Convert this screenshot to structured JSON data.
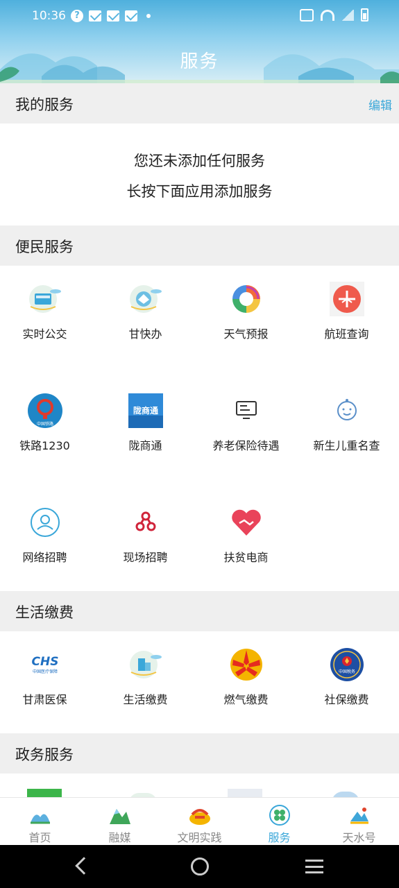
{
  "status_bar": {
    "time": "10:36",
    "question_glyph": "?"
  },
  "header": {
    "title": "服务"
  },
  "my_services": {
    "title": "我的服务",
    "edit_label": "编辑",
    "empty_line1": "您还未添加任何服务",
    "empty_line2": "长按下面应用添加服务"
  },
  "convenience": {
    "title": "便民服务",
    "items": [
      {
        "label": "实时公交",
        "icon": "bus-card-icon"
      },
      {
        "label": "甘快办",
        "icon": "gankuaiban-icon"
      },
      {
        "label": "天气预报",
        "icon": "weather-icon"
      },
      {
        "label": "航班查询",
        "icon": "flight-icon"
      },
      {
        "label": "铁路1230",
        "icon": "railway-icon",
        "badge": "中国铁路"
      },
      {
        "label": "陇商通",
        "icon": "longshangtong-icon",
        "badge": "陇商通"
      },
      {
        "label": "养老保险待遇",
        "icon": "pension-icon"
      },
      {
        "label": "新生儿重名查",
        "icon": "baby-icon"
      },
      {
        "label": "网络招聘",
        "icon": "online-recruit-icon"
      },
      {
        "label": "现场招聘",
        "icon": "onsite-recruit-icon"
      },
      {
        "label": "扶贫电商",
        "icon": "poverty-ecommerce-icon"
      }
    ]
  },
  "payments": {
    "title": "生活缴费",
    "items": [
      {
        "label": "甘肃医保",
        "icon": "medical-insurance-icon",
        "badge": "CHS",
        "sub": "中国医疗保障"
      },
      {
        "label": "生活缴费",
        "icon": "utilities-icon"
      },
      {
        "label": "燃气缴费",
        "icon": "gas-icon"
      },
      {
        "label": "社保缴费",
        "icon": "social-security-icon",
        "badge": "中国税务"
      }
    ]
  },
  "government": {
    "title": "政务服务"
  },
  "bottom_nav": [
    {
      "label": "首页",
      "icon": "home-icon"
    },
    {
      "label": "融媒",
      "icon": "media-icon"
    },
    {
      "label": "文明实践",
      "icon": "civilization-icon"
    },
    {
      "label": "服务",
      "icon": "service-icon",
      "active": true
    },
    {
      "label": "天水号",
      "icon": "tianshui-icon"
    }
  ],
  "colors": {
    "accent": "#3aa7d9",
    "section_bg": "#efefef",
    "header_sky": "#4fb0dd"
  }
}
